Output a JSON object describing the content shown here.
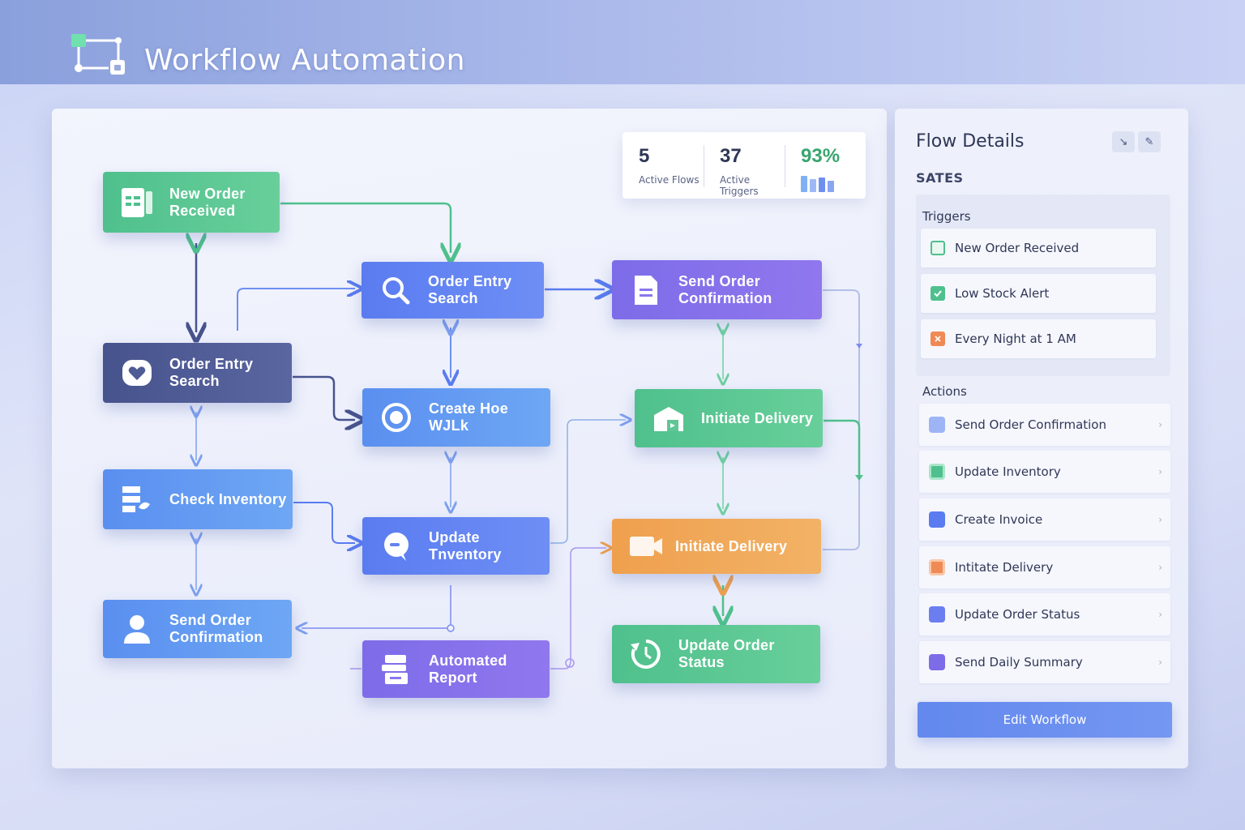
{
  "app": {
    "title": "Workflow Automation"
  },
  "stats": [
    {
      "value": "5",
      "label": "Active Flows"
    },
    {
      "value": "37",
      "label": "Active Triggers"
    },
    {
      "value": "93%",
      "label": ""
    }
  ],
  "nodes": {
    "new_order_received": "New Order Received",
    "order_entry_search_top": "Order Entry Search",
    "send_order_confirmation_top": "Send Order Confirmation",
    "order_entry_search_left": "Order Entry Search",
    "create_hoe_walk": "Create Hoe WJLk",
    "initiate_delivery_green": "Initiate Delivery",
    "check_inventory": "Check Inventory",
    "update_inventory": "Update Tnventory",
    "initiate_delivery_orange": "Initiate Delivery",
    "send_order_confirmation_bottom": "Send Order Confirmation",
    "automated_report": "Automated Report",
    "update_order_status": "Update Order Status"
  },
  "panel": {
    "title": "Flow Details",
    "section_heading": "SATES",
    "minimize_glyph": "↘",
    "pin_glyph": "✎",
    "triggers_title": "Triggers",
    "triggers": [
      {
        "label": "New Order Received",
        "color": "#4fc08d",
        "icon": "square-outline-icon"
      },
      {
        "label": "Low Stock Alert",
        "color": "#4fc08d",
        "icon": "check-square-icon"
      },
      {
        "label": "Every Night at 1 AM",
        "color": "#ef8a55",
        "icon": "clock-square-icon"
      }
    ],
    "actions_title": "Actions",
    "actions": [
      {
        "label": "Send Order Confirmation",
        "color": "#7fa0f2"
      },
      {
        "label": "Update Inventory",
        "color": "#4fc08d"
      },
      {
        "label": "Create Invoice",
        "color": "#5a7cf0"
      },
      {
        "label": "Intitate Delivery",
        "color": "#ef8a55"
      },
      {
        "label": "Update Order Status",
        "color": "#6b7ef0"
      },
      {
        "label": "Send Daily Summary",
        "color": "#7d6ce8"
      }
    ],
    "chevron": "›",
    "edit_button": "Edit Workflow"
  },
  "colors": {
    "green": "#4fc08d",
    "blue": "#5a7cf0",
    "navy": "#47538d",
    "purple": "#7d6ce8",
    "orange": "#efa04e"
  }
}
